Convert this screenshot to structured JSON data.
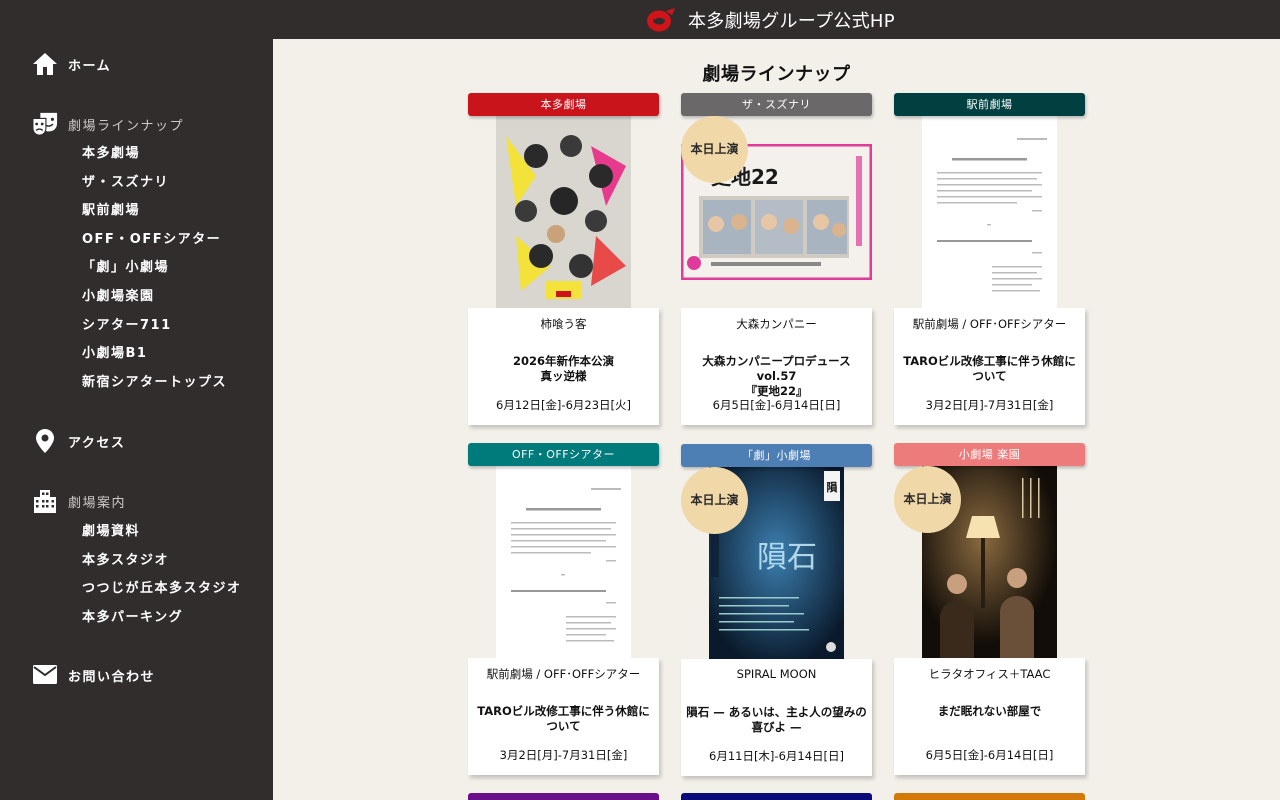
{
  "header": {
    "title": "本多劇場グループ公式HP"
  },
  "sidebar": {
    "home": "ホーム",
    "lineup": "劇場ラインナップ",
    "lineup_items": [
      "本多劇場",
      "ザ・スズナリ",
      "駅前劇場",
      "OFF・OFFシアター",
      "「劇」小劇場",
      "小劇場楽園",
      "シアター711",
      "小劇場B1",
      "新宿シアタートップス"
    ],
    "access": "アクセス",
    "guide": "劇場案内",
    "guide_items": [
      "劇場資料",
      "本多スタジオ",
      "つつじが丘本多スタジオ",
      "本多パーキング"
    ],
    "contact": "お問い合わせ"
  },
  "main": {
    "page_title": "劇場ラインナップ",
    "today_badge": "本日上演",
    "cards": [
      {
        "venue": "本多劇場",
        "venue_color": "#c8141a",
        "company": "柿喰う客",
        "title": "2026年新作本公演\n真ッ逆様",
        "dates": "6月12日[金]-6月23日[火]"
      },
      {
        "venue": "ザ・スズナリ",
        "venue_color": "#6a6868",
        "company": "大森カンパニー",
        "title": "大森カンパニープロデュースvol.57\n『更地22』",
        "dates": "6月5日[金]-6月14日[日]",
        "poster_text": "更地22"
      },
      {
        "venue": "駅前劇場",
        "venue_color": "#004040",
        "company": "駅前劇場 / OFF･OFFシアター",
        "title": "TAROビル改修工事に伴う休館について",
        "dates": "3月2日[月]-7月31日[金]"
      },
      {
        "venue": "OFF・OFFシアター",
        "venue_color": "#007b7b",
        "company": "駅前劇場 / OFF･OFFシアター",
        "title": "TAROビル改修工事に伴う休館について",
        "dates": "3月2日[月]-7月31日[金]"
      },
      {
        "venue": "「劇」小劇場",
        "venue_color": "#4e7fb4",
        "company": "SPIRAL MOON",
        "title": "隕石 — あるいは、主よ人の望みの喜びよ —",
        "dates": "6月11日[木]-6月14日[日]",
        "poster_text": "隕石"
      },
      {
        "venue": "小劇場 楽園",
        "venue_color": "#ee7b7b",
        "company": "ヒラタオフィス＋TAAC",
        "title": "まだ眠れない部屋で",
        "dates": "6月5日[金]-6月14日[日]"
      }
    ],
    "next_row_colors": [
      "#6a0f8a",
      "#0a0a7a",
      "#d37a0a"
    ]
  }
}
